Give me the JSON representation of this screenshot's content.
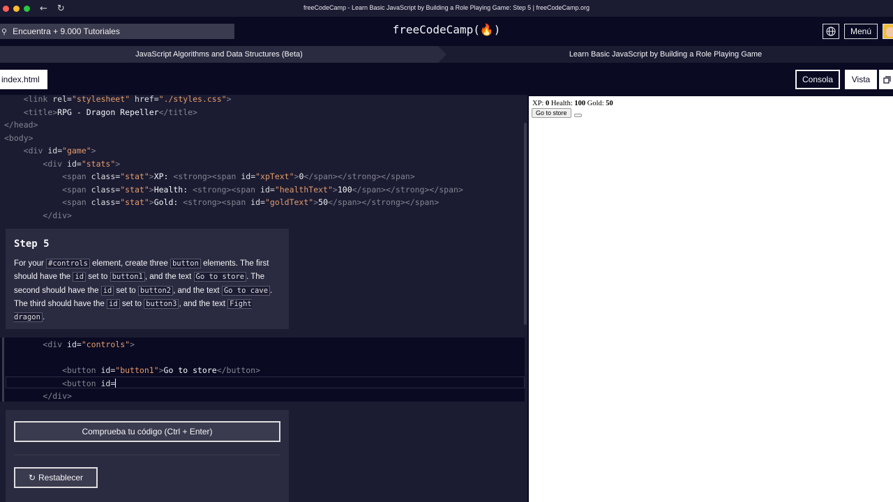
{
  "window": {
    "title": "freeCodeCamp - Learn Basic JavaScript by Building a Role Playing Game: Step 5 | freeCodeCamp.org"
  },
  "header": {
    "search_placeholder": "Encuentra + 9.000 Tutoriales",
    "logo": "freeCodeCamp(🔥)",
    "menu_label": "Menú"
  },
  "breadcrumb": {
    "superblock": "JavaScript Algorithms and Data Structures (Beta)",
    "block": "Learn Basic JavaScript by Building a Role Playing Game"
  },
  "tabs": {
    "file": "index.html",
    "console": "Consola",
    "preview": "Vista"
  },
  "step": {
    "title": "Step 5",
    "desc": {
      "p1": "For your ",
      "c1": "#controls",
      "p2": " element, create three ",
      "c2": "button",
      "p3": " elements. The first should have the ",
      "c3": "id",
      "p4": " set to ",
      "c4": "button1",
      "p5": ", and the text ",
      "c5": "Go to store",
      "p6": ". The second should have the ",
      "c6": "id",
      "p7": " set to ",
      "c7": "button2",
      "p8": ", and the text ",
      "c8": "Go to cave",
      "p9": ". The third should have the ",
      "c9": "id",
      "p10": " set to ",
      "c10": "button3",
      "p11": ", and the text ",
      "c11": "Fight dragon",
      "p12": "."
    }
  },
  "code_top": {
    "l1": {
      "t1": "<link ",
      "a1": "rel",
      "e1": "=",
      "v1": "\"stylesheet\"",
      "s": " ",
      "a2": "href",
      "e2": "=",
      "v2": "\"./styles.css\"",
      "t2": ">"
    },
    "l2": {
      "t1": "<title>",
      "x": "RPG - Dragon Repeller",
      "t2": "</title>"
    },
    "l3": {
      "t": "</head>"
    },
    "l4": {
      "t": "<body>"
    },
    "l5": {
      "t1": "<div ",
      "a": "id",
      "e": "=",
      "v": "\"game\"",
      "t2": ">"
    },
    "l6": {
      "t1": "<div ",
      "a": "id",
      "e": "=",
      "v": "\"stats\"",
      "t2": ">"
    },
    "l7": {
      "t1": "<span ",
      "a": "class",
      "e": "=",
      "v": "\"stat\"",
      "t2": ">",
      "x1": "XP: ",
      "t3": "<strong><span ",
      "a2": "id",
      "e2": "=",
      "v2": "\"xpText\"",
      "t4": ">",
      "x2": "0",
      "t5": "</span></strong></span>"
    },
    "l8": {
      "t1": "<span ",
      "a": "class",
      "e": "=",
      "v": "\"stat\"",
      "t2": ">",
      "x1": "Health: ",
      "t3": "<strong><span ",
      "a2": "id",
      "e2": "=",
      "v2": "\"healthText\"",
      "t4": ">",
      "x2": "100",
      "t5": "</span></strong></span>"
    },
    "l9": {
      "t1": "<span ",
      "a": "class",
      "e": "=",
      "v": "\"stat\"",
      "t2": ">",
      "x1": "Gold: ",
      "t3": "<strong><span ",
      "a2": "id",
      "e2": "=",
      "v2": "\"goldText\"",
      "t4": ">",
      "x2": "50",
      "t5": "</span></strong></span>"
    },
    "l10": {
      "t": "</div>"
    }
  },
  "code_edit": {
    "l1": {
      "t1": "<div ",
      "a": "id",
      "e": "=",
      "v": "\"controls\"",
      "t2": ">"
    },
    "l3": {
      "t1": "<button ",
      "a": "id",
      "e": "=",
      "v": "\"button1\"",
      "t2": ">",
      "x": "Go to store",
      "t3": "</button>"
    },
    "l4": {
      "t1": "<button ",
      "a": "id",
      "e": "="
    },
    "l5": {
      "t": "</div>"
    }
  },
  "actions": {
    "check": "Comprueba tu código (Ctrl + Enter)",
    "reset": "Restablecer"
  },
  "preview": {
    "xp_label": "XP: ",
    "xp": "0",
    "health_label": " Health: ",
    "health": "100",
    "gold_label": " Gold: ",
    "gold": "50",
    "button1": "Go to store"
  }
}
